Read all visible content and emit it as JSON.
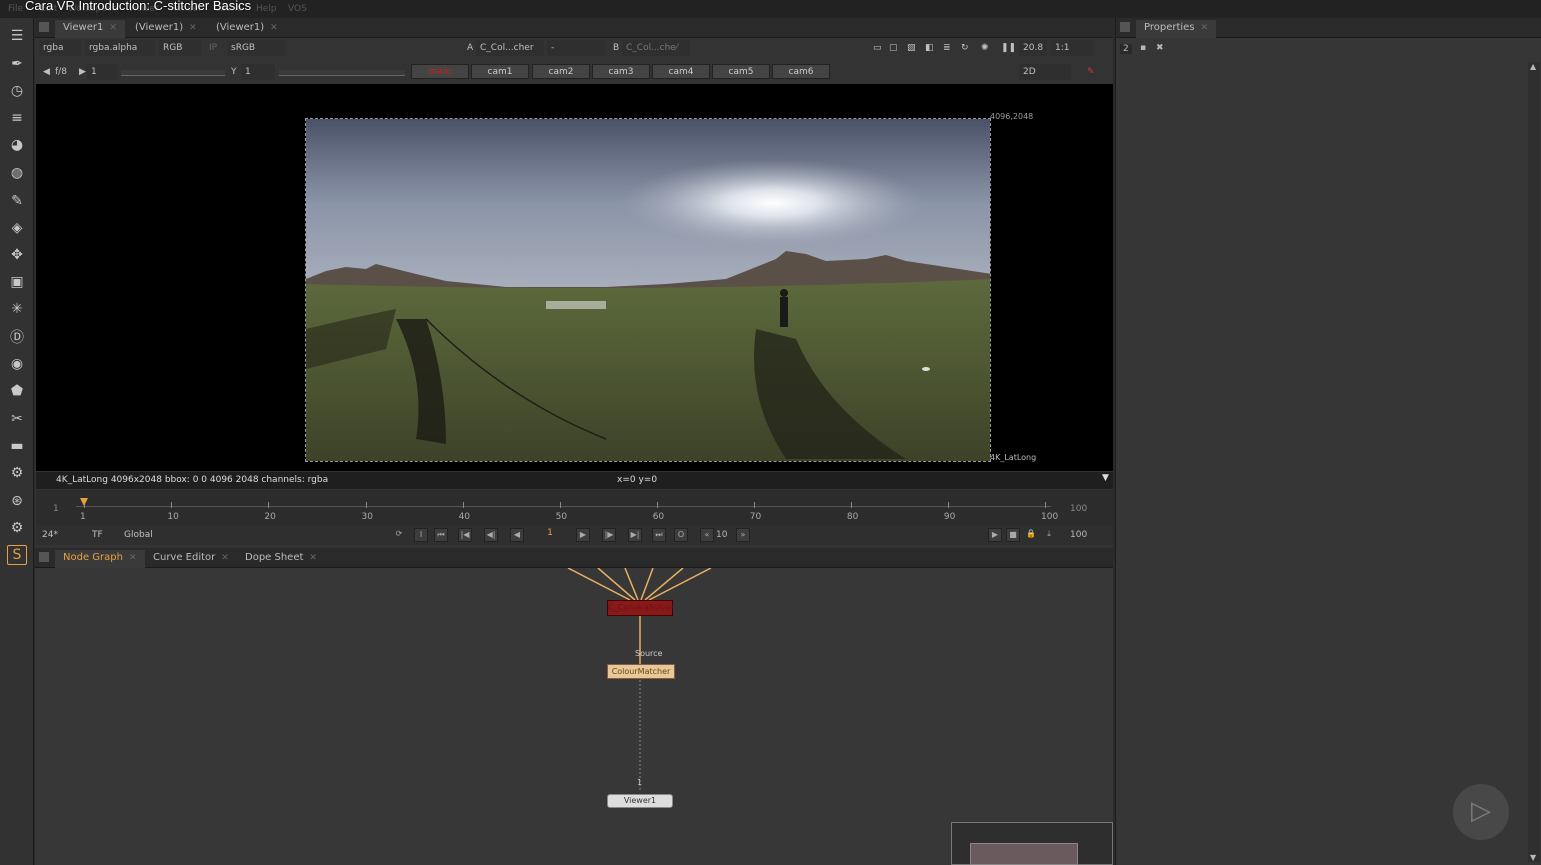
{
  "title": "Cara VR Introduction: C-stitcher Basics",
  "menu": [
    "File",
    "Edit",
    "Workspace",
    "Viewer",
    "Render",
    "Cache",
    "Help",
    "VOS"
  ],
  "viewer_tabs": [
    {
      "label": "Viewer1"
    },
    {
      "label": "(Viewer1)"
    },
    {
      "label": "(Viewer1)"
    }
  ],
  "viewer_controls": {
    "channels": "rgba",
    "alpha": "rgba.alpha",
    "display": "RGB",
    "ip": "IP",
    "lut": "sRGB",
    "a_label": "A",
    "a_input": "C_Col...cher",
    "op": "-",
    "b_label": "B",
    "b_input": "C_Col...che⁄",
    "zoom": "20.8",
    "ratio": "1:1",
    "fstop": "f/8",
    "gain": "1",
    "y_label": "Y",
    "gamma": "1",
    "view_mode": "2D"
  },
  "cam_tabs": [
    "main",
    "cam1",
    "cam2",
    "cam3",
    "cam4",
    "cam5",
    "cam6"
  ],
  "viewport": {
    "res_label": "4096,2048",
    "format_label": "4K_LatLong"
  },
  "infobar": {
    "left": "4K_LatLong 4096x2048  bbox: 0 0 4096 2048 channels: rgba",
    "center": "x=0 y=0"
  },
  "timeline": {
    "start": "1",
    "end": "100",
    "ticks": [
      "1",
      "10",
      "20",
      "30",
      "40",
      "50",
      "60",
      "70",
      "80",
      "90",
      "100"
    ],
    "current": 1
  },
  "playback": {
    "fps": "24*",
    "tf": "TF",
    "scope": "Global",
    "frame": "1",
    "step": "10",
    "end_frame": "100"
  },
  "panel_tabs": [
    {
      "label": "Node Graph",
      "active": true
    },
    {
      "label": "Curve Editor"
    },
    {
      "label": "Dope Sheet"
    }
  ],
  "nodes": {
    "stitch": {
      "label": "C_CameraSolver"
    },
    "colour": {
      "label": "ColourMatcher",
      "input_label": "Source"
    },
    "viewer": {
      "label": "Viewer1",
      "input_num": "1"
    }
  },
  "properties": {
    "tab": "Properties",
    "count": "2"
  },
  "colors": {
    "accent": "#e8a040",
    "stitch_node": "#8a1a1a",
    "colour_node": "#e8c898"
  }
}
